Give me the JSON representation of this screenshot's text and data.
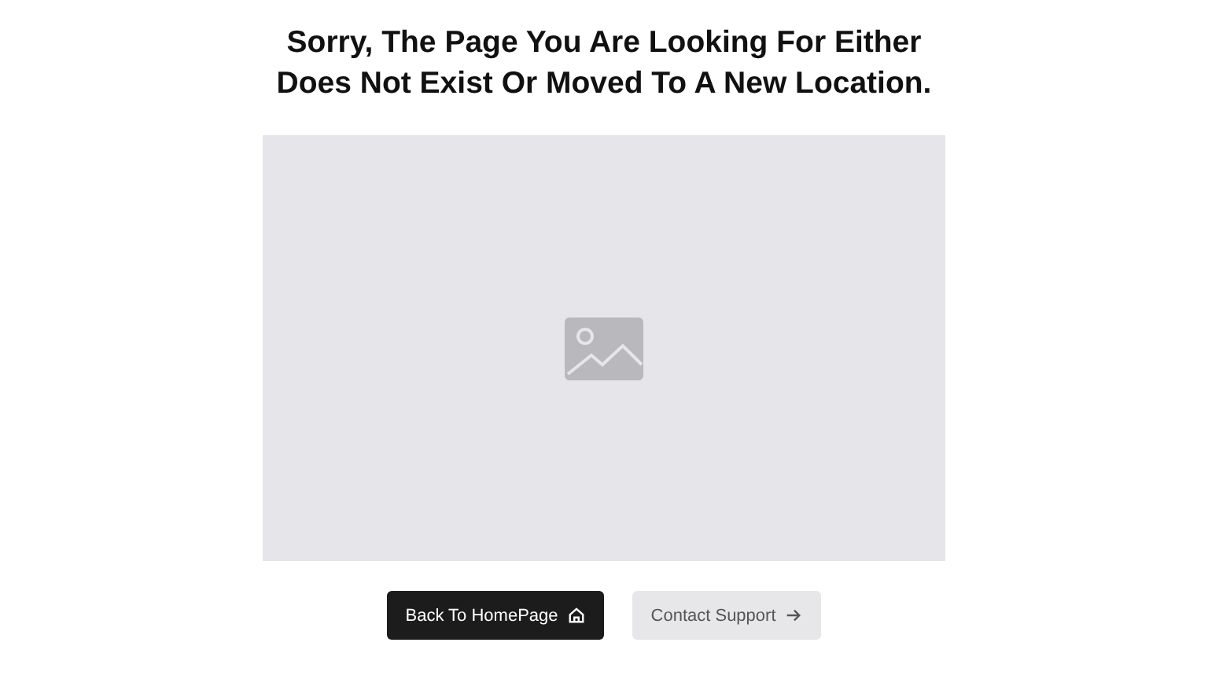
{
  "heading": "Sorry, The Page You Are Looking For Either Does Not Exist Or Moved To A New Location.",
  "image_placeholder": {
    "kind": "placeholder"
  },
  "buttons": [
    {
      "label": "Back To HomePage",
      "kind": "primary"
    },
    {
      "label": "Contact Support",
      "kind": "secondary"
    }
  ]
}
